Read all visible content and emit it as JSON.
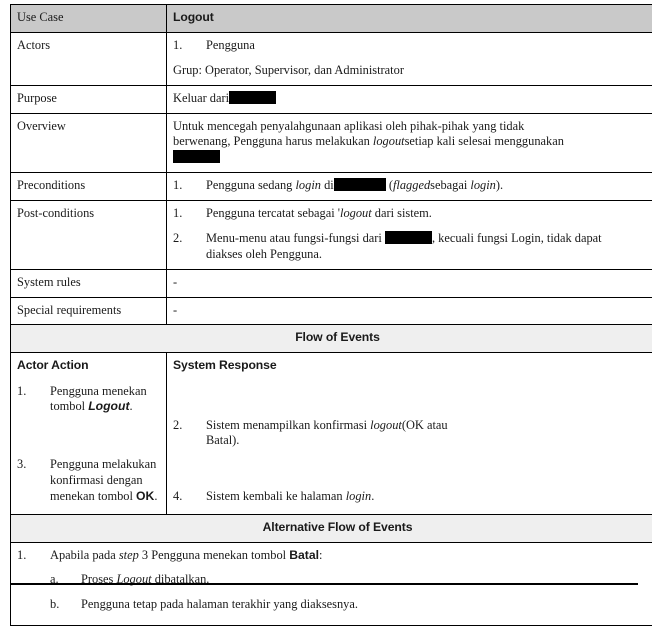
{
  "document": {
    "type": "use-case-specification-table",
    "rows": {
      "use_case": {
        "label": "Use Case",
        "value": "Logout"
      },
      "actors": {
        "label": "Actors",
        "items": [
          "Pengguna"
        ],
        "note": "Grup: Operator, Supervisor, dan Administrator"
      },
      "purpose": {
        "label": "Purpose",
        "text_before": "Keluar dari",
        "redacted": true
      },
      "overview": {
        "label": "Overview",
        "line1": "Untuk mencegah penyalahgunaan aplikasi oleh pihak-pihak yang tidak",
        "line2_a": "berwenang, Pengguna harus melakukan",
        "line2_italic": "logout",
        "line2_b": "setiap kali selesai menggunakan",
        "line3_redacted": true
      },
      "preconditions": {
        "label": "Preconditions",
        "item1_a": "Pengguna sedang",
        "item1_italic1": "login",
        "item1_b": "di",
        "item1_redacted": true,
        "item1_c": "(",
        "item1_italic2": "flagged",
        "item1_d": "sebagai",
        "item1_italic3": "login",
        "item1_e": ")."
      },
      "postconditions": {
        "label": "Post-conditions",
        "item1_a": "Pengguna tercatat sebagai '",
        "item1_italic": "logout",
        "item1_b": "dari sistem.",
        "item2_a": "Menu-menu atau fungsi-fungsi dari",
        "item2_redacted": true,
        "item2_b": ", kecuali fungsi Login, tidak dapat",
        "item2_c": "diakses oleh Pengguna."
      },
      "system_rules": {
        "label": "System rules",
        "value": "-"
      },
      "special_requirements": {
        "label": "Special requirements",
        "value": "-"
      }
    },
    "flow_of_events": {
      "title": "Flow of Events",
      "actor_column_header": "Actor Action",
      "system_column_header": "System Response",
      "actor_steps": [
        {
          "number": "1.",
          "text_a": "Pengguna menekan tombol",
          "bold_italic": "Logout",
          "text_b": "."
        },
        {
          "number": "3.",
          "text_a": "Pengguna melakukan konfirmasi dengan",
          "text_b": "menekan tombol",
          "bold": "OK",
          "text_c": "."
        }
      ],
      "system_steps": [
        {
          "number": "2.",
          "text_a": "Sistem menampilkan konfirmasi",
          "italic": "logout",
          "text_b": "(OK atau",
          "text_c": "Batal)."
        },
        {
          "number": "4.",
          "text_a": "Sistem kembali ke halaman",
          "italic": "login",
          "text_b": "."
        }
      ]
    },
    "alternative_flow_of_events": {
      "title": "Alternative Flow of Events",
      "items": [
        {
          "number": "1.",
          "text_a": "Apabila pada",
          "italic": "step",
          "text_b": "3 Pengguna menekan tombol",
          "bold": "Batal",
          "text_c": ":",
          "subitems": [
            {
              "marker": "a.",
              "text_a": "Proses",
              "italic": "Logout",
              "text_b": "dibatalkan."
            },
            {
              "marker": "b.",
              "text_a": "Pengguna tetap pada halaman terakhir yang diaksesnya.",
              "italic": "",
              "text_b": ""
            }
          ]
        }
      ]
    }
  }
}
